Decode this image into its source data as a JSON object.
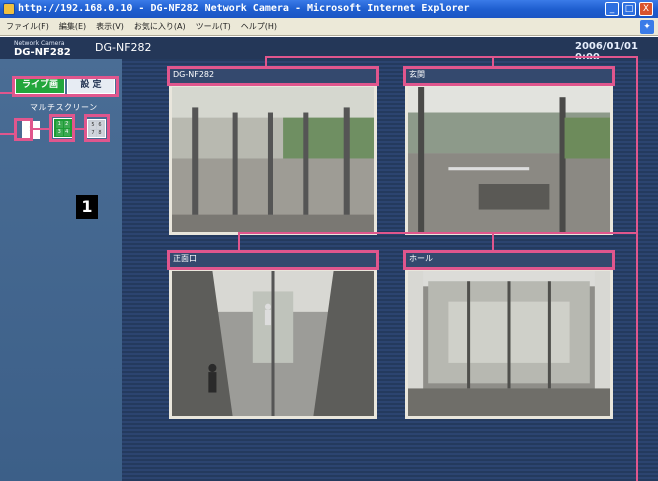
{
  "window": {
    "title": "http://192.168.0.10 - DG-NF282 Network Camera - Microsoft Internet Explorer",
    "btn_min": "_",
    "btn_max": "□",
    "btn_close": "X"
  },
  "menu": {
    "items": [
      "ファイル(F)",
      "編集(E)",
      "表示(V)",
      "お気に入り(A)",
      "ツール(T)",
      "ヘルプ(H)"
    ]
  },
  "header": {
    "network_camera_label": "Network Camera",
    "model": "DG-NF282",
    "title": "DG-NF282",
    "datetime": "2006/01/01  0:00"
  },
  "sidebar": {
    "tab_live": "ライブ画",
    "tab_setup": "設 定",
    "multi_screen_label": "マルチスクリーン",
    "view_1": "1",
    "view_4": [
      "1",
      "2",
      "3",
      "4"
    ],
    "view_8": [
      "5",
      "6",
      "7",
      "8"
    ],
    "badge": "1"
  },
  "cameras": [
    {
      "title": "DG-NF282"
    },
    {
      "title": "玄関"
    },
    {
      "title": "正面口"
    },
    {
      "title": "ホール"
    }
  ],
  "colors": {
    "accent_live": "#22a63c",
    "callout": "#e0568d",
    "page_bg": "#2a3e63"
  }
}
